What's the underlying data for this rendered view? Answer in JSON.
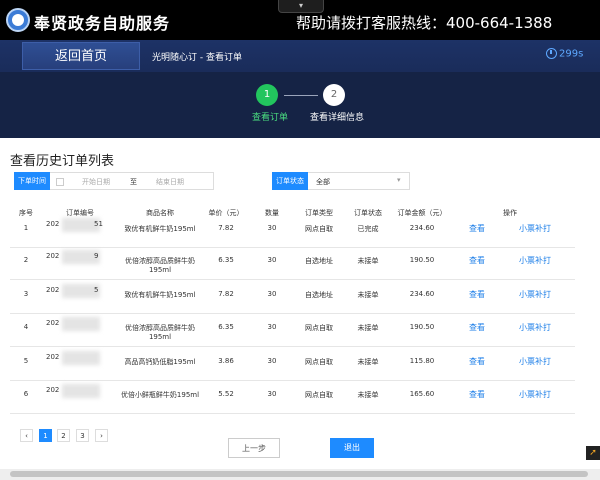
{
  "header": {
    "app_title": "奉贤政务自助服务",
    "hotline": "帮助请拨打客服热线：400-664-1388",
    "dropdown_glyph": "▾"
  },
  "nav": {
    "home_button": "返回首页",
    "breadcrumb": "光明随心订 - 查看订单",
    "timer": "299s"
  },
  "steps": [
    {
      "number": "1",
      "label": "查看订单",
      "state": "active"
    },
    {
      "number": "2",
      "label": "查看详细信息",
      "state": "pending"
    }
  ],
  "section_title": "查看历史订单列表",
  "filters": {
    "time_label": "下单时间",
    "start_placeholder": "开始日期",
    "separator": "至",
    "end_placeholder": "结束日期",
    "status_label": "订单状态",
    "status_value": "全部"
  },
  "table": {
    "headers": [
      "序号",
      "订单编号",
      "商品名称",
      "单价（元）",
      "数量",
      "订单类型",
      "订单状态",
      "订单金额（元）",
      "操作"
    ],
    "rows": [
      {
        "index": "1",
        "order_prefix": "202",
        "order_suffix": "51",
        "product": "致优有机鲜牛奶195ml",
        "price": "7.82",
        "qty": "30",
        "type": "网点自取",
        "status": "已完成",
        "amount": "234.60",
        "action_view": "查看",
        "action_print": "小票补打"
      },
      {
        "index": "2",
        "order_prefix": "202",
        "order_suffix": "9",
        "product": "优倍浓醇高品质鲜牛奶195ml",
        "price": "6.35",
        "qty": "30",
        "type": "自选地址",
        "status": "未接单",
        "amount": "190.50",
        "action_view": "查看",
        "action_print": "小票补打"
      },
      {
        "index": "3",
        "order_prefix": "202",
        "order_suffix": "5",
        "product": "致优有机鲜牛奶195ml",
        "price": "7.82",
        "qty": "30",
        "type": "自选地址",
        "status": "未接单",
        "amount": "234.60",
        "action_view": "查看",
        "action_print": "小票补打"
      },
      {
        "index": "4",
        "order_prefix": "202",
        "order_suffix": "",
        "product": "优倍浓醇高品质鲜牛奶195ml",
        "price": "6.35",
        "qty": "30",
        "type": "网点自取",
        "status": "未接单",
        "amount": "190.50",
        "action_view": "查看",
        "action_print": "小票补打"
      },
      {
        "index": "5",
        "order_prefix": "202",
        "order_suffix": "",
        "product": "高品高钙奶低脂195ml",
        "price": "3.86",
        "qty": "30",
        "type": "网点自取",
        "status": "未接单",
        "amount": "115.80",
        "action_view": "查看",
        "action_print": "小票补打"
      },
      {
        "index": "6",
        "order_prefix": "202",
        "order_suffix": "",
        "product": "优倍小鲜瓶鲜牛奶195ml",
        "price": "5.52",
        "qty": "30",
        "type": "网点自取",
        "status": "未接单",
        "amount": "165.60",
        "action_view": "查看",
        "action_print": "小票补打"
      }
    ]
  },
  "pagination": {
    "prev": "‹",
    "pages": [
      "1",
      "2",
      "3"
    ],
    "next": "›",
    "current": "1"
  },
  "buttons": {
    "prev_step": "上一步",
    "exit": "退出"
  },
  "colors": {
    "accent": "#1e8bff",
    "nav_bg": "#1d3266",
    "step_active": "#22c55e"
  }
}
